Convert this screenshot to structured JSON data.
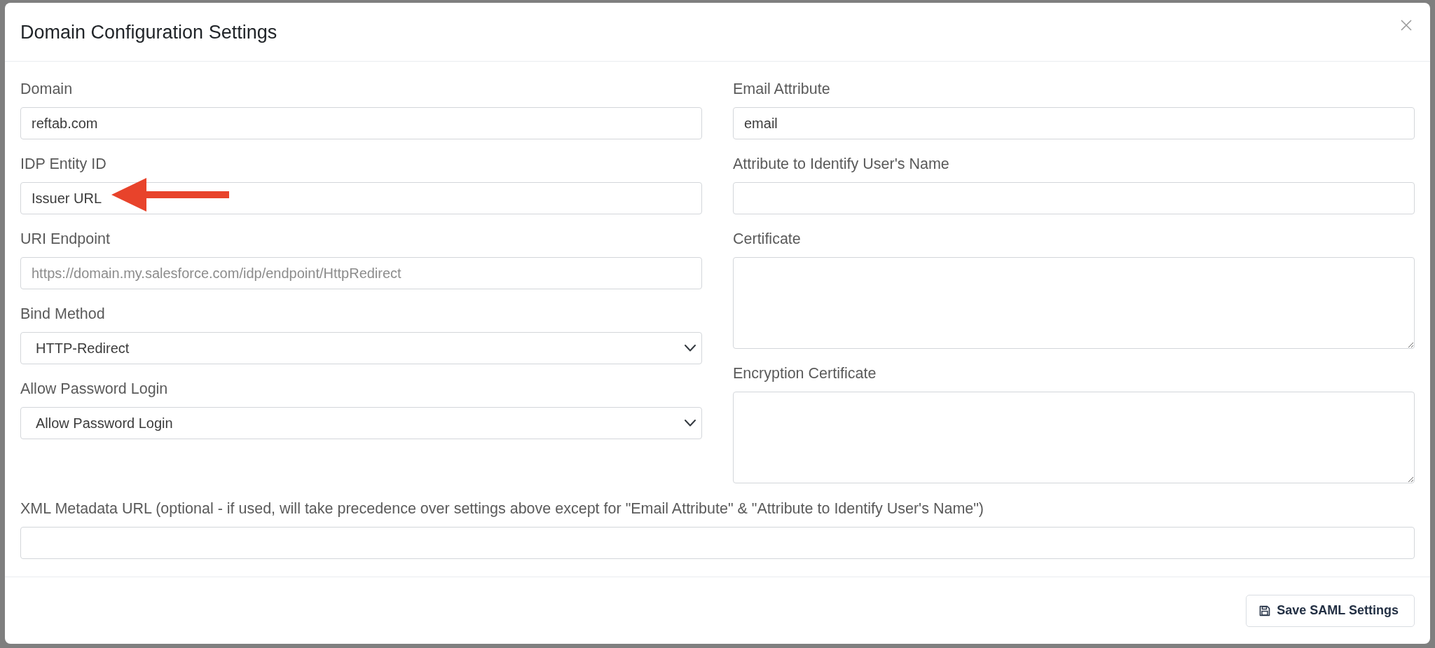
{
  "dialog": {
    "title": "Domain Configuration Settings"
  },
  "columns": [
    {
      "fields": [
        {
          "label": "Domain",
          "kind": "input",
          "value": "reftab.com",
          "annotated": false
        },
        {
          "label": "IDP Entity ID",
          "kind": "input",
          "value": "Issuer URL",
          "annotated": true
        },
        {
          "label": "URI Endpoint",
          "kind": "input",
          "placeholder": "https://domain.my.salesforce.com/idp/endpoint/HttpRedirect",
          "annotated": false
        },
        {
          "label": "Bind Method",
          "kind": "select",
          "value": "HTTP-Redirect",
          "annotated": false
        },
        {
          "label": "Allow Password Login",
          "kind": "select",
          "value": "Allow Password Login",
          "annotated": false
        }
      ]
    },
    {
      "fields": [
        {
          "label": "Email Attribute",
          "kind": "input",
          "value": "email",
          "annotated": false
        },
        {
          "label": "Attribute to Identify User's Name",
          "kind": "input",
          "annotated": false
        },
        {
          "label": "Certificate",
          "kind": "textarea",
          "annotated": false
        },
        {
          "label": "Encryption Certificate",
          "kind": "textarea",
          "annotated": false
        }
      ]
    }
  ],
  "wide_field": {
    "label": "XML Metadata URL (optional - if used, will take precedence over settings above except for \"Email Attribute\" & \"Attribute to Identify User's Name\")",
    "kind": "input"
  },
  "footer": {
    "buttons": [
      {
        "label": "Save SAML Settings",
        "kind": "save"
      }
    ]
  }
}
